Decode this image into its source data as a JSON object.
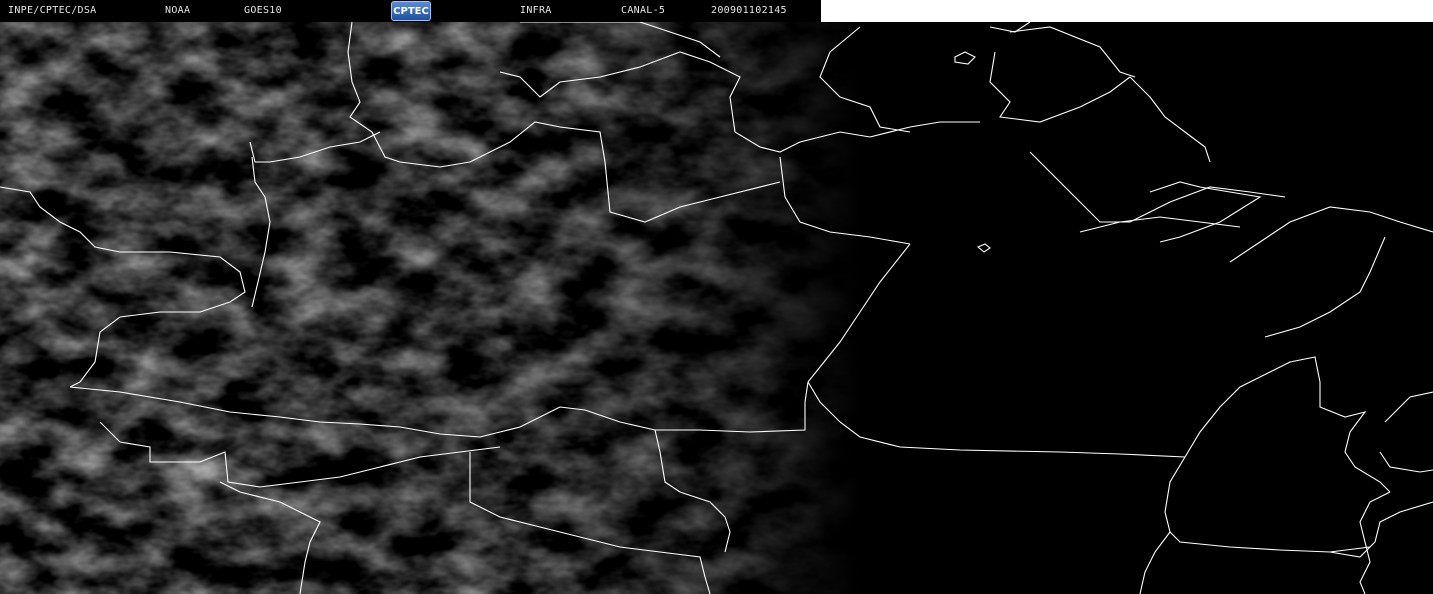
{
  "header": {
    "org": "INPE/CPTEC/DSA",
    "agency": "NOAA",
    "satellite": "GOES10",
    "logo_text": "CPTEC",
    "product": "INFRA",
    "channel": "CANAL-5",
    "timestamp": "200901102145"
  },
  "colors": {
    "background": "#000000",
    "border_lines": "#ffffff",
    "header_text": "#e6e6e6",
    "cloud_gray": "#7a7a7a"
  }
}
